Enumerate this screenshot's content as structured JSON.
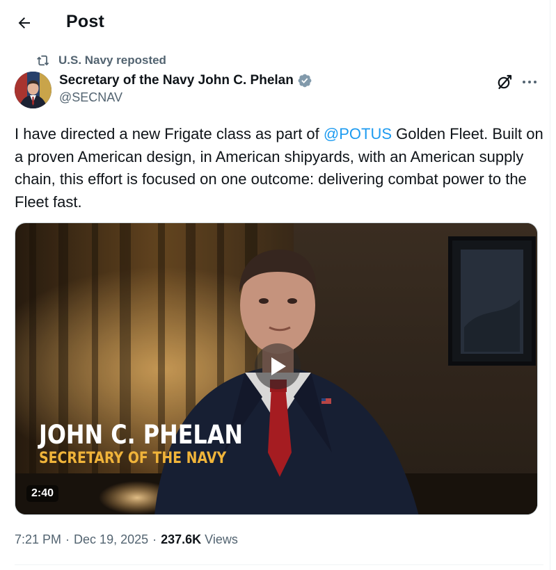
{
  "header": {
    "title": "Post",
    "back_icon": "arrow-left-icon"
  },
  "repost": {
    "text": "U.S. Navy reposted",
    "icon": "repost-icon"
  },
  "author": {
    "name": "Secretary of the Navy John C. Phelan",
    "handle": "@SECNAV",
    "verified_icon": "verified-badge-icon",
    "verified_color": "#829aab"
  },
  "post": {
    "text_before": "I have directed a new Frigate class as part of ",
    "mention": "@POTUS",
    "text_after": " Golden Fleet. Built on a proven American design, in American shipyards, with an American supply chain, this effort is focused on one outcome: delivering combat power to the Fleet fast.",
    "mention_color": "#1d9bf0"
  },
  "video": {
    "overlay_name": "JOHN C. PHELAN",
    "overlay_title": "SECRETARY OF THE NAVY",
    "duration": "2:40",
    "play_icon": "play-icon",
    "overlay_title_color": "#f0b43a"
  },
  "meta": {
    "time": "7:21 PM",
    "separator": "·",
    "date": "Dec 19, 2025",
    "views_count": "237.6K",
    "views_label": "Views"
  },
  "actions": {
    "grok_icon": "grok-icon",
    "more_icon": "more-horizontal-icon"
  }
}
